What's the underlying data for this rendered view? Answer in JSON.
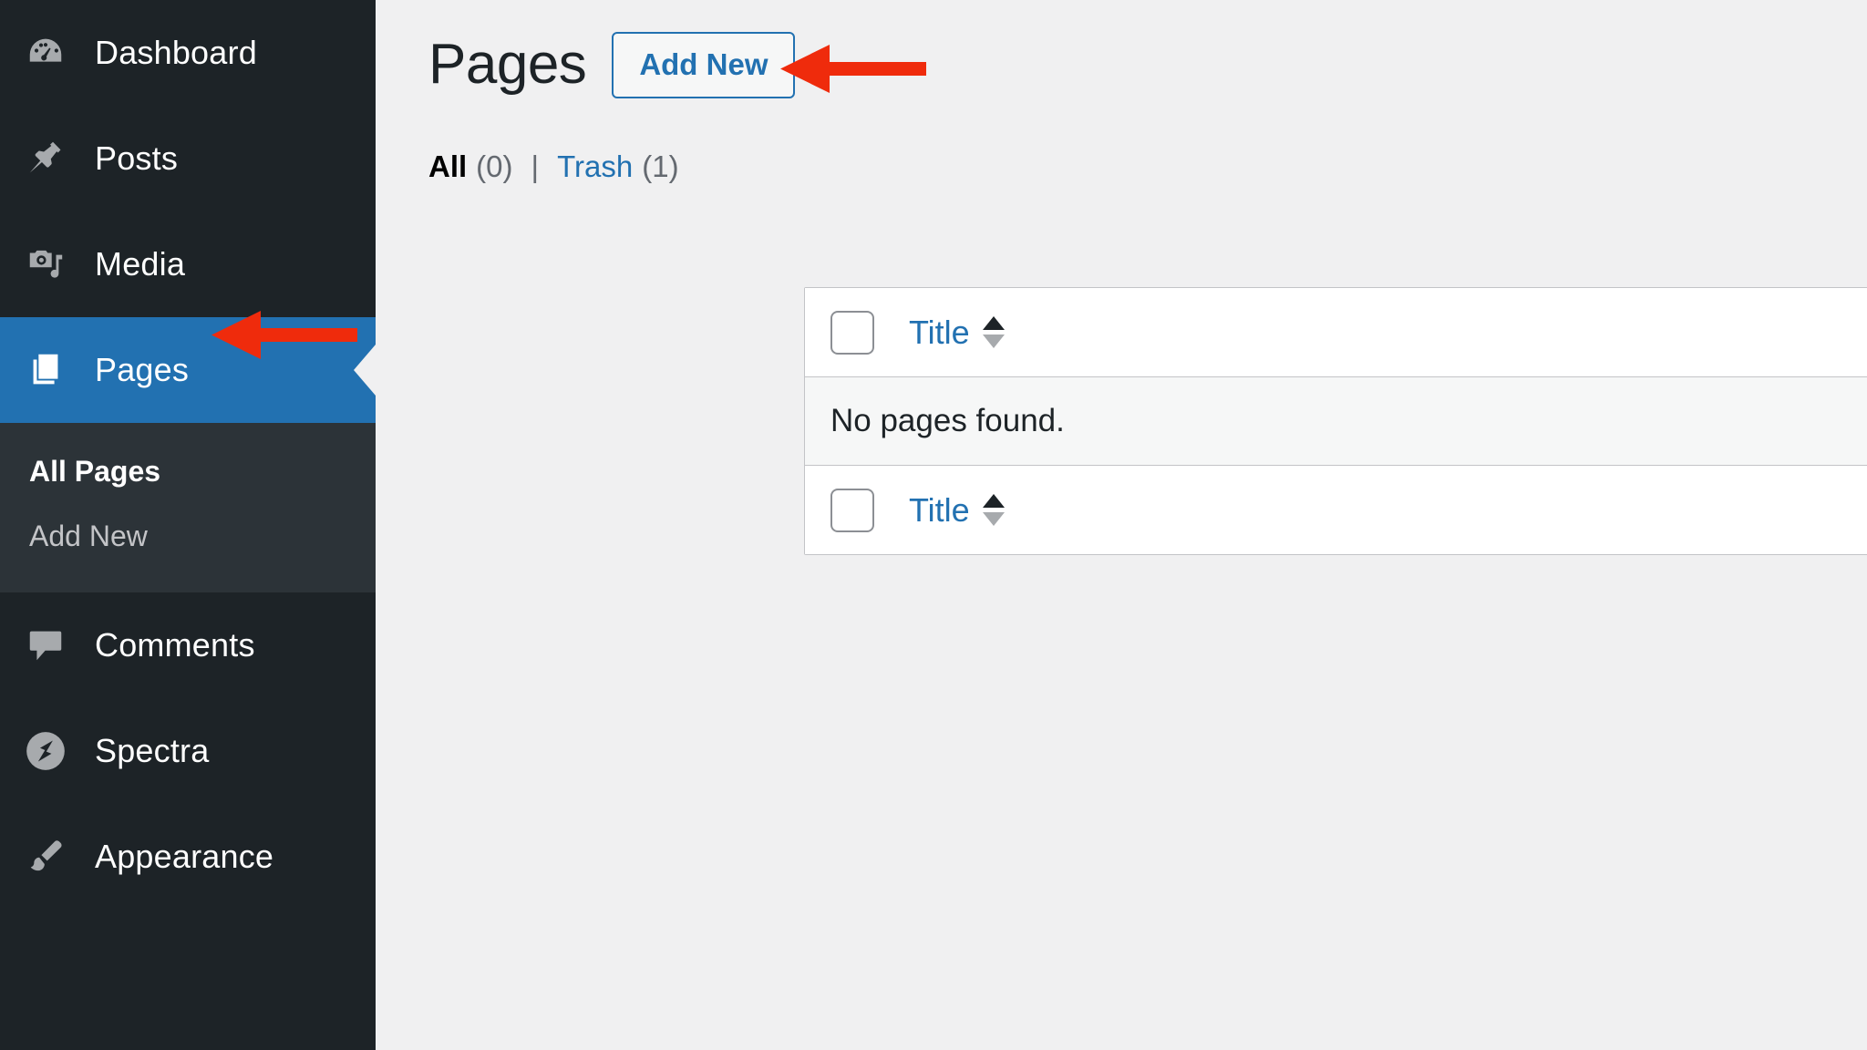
{
  "sidebar": {
    "items": [
      {
        "label": "Dashboard",
        "icon": "dashboard-icon",
        "current": false
      },
      {
        "label": "Posts",
        "icon": "pin-icon",
        "current": false
      },
      {
        "label": "Media",
        "icon": "media-icon",
        "current": false
      },
      {
        "label": "Pages",
        "icon": "pages-icon",
        "current": true
      },
      {
        "label": "Comments",
        "icon": "comment-icon",
        "current": false
      },
      {
        "label": "Spectra",
        "icon": "spectra-icon",
        "current": false
      },
      {
        "label": "Appearance",
        "icon": "brush-icon",
        "current": false
      }
    ],
    "submenu": [
      {
        "label": "All Pages",
        "current": true
      },
      {
        "label": "Add New",
        "current": false
      }
    ]
  },
  "header": {
    "title": "Pages",
    "add_new_label": "Add New"
  },
  "filters": {
    "all_label": "All",
    "all_count": "(0)",
    "separator": "|",
    "trash_label": "Trash",
    "trash_count": "(1)"
  },
  "table": {
    "header_title": "Title",
    "footer_title": "Title",
    "empty_message": "No pages found."
  },
  "annotations": {
    "arrow_color": "#ef2b0c",
    "arrow_add_new": "arrow-left-icon",
    "arrow_pages": "arrow-left-icon"
  },
  "colors": {
    "sidebar_bg": "#1d2327",
    "submenu_bg": "#2c3338",
    "current_highlight": "#2271b1",
    "link": "#2271b1",
    "content_bg": "#f0f0f1",
    "annotation_red": "#ef2b0c"
  }
}
